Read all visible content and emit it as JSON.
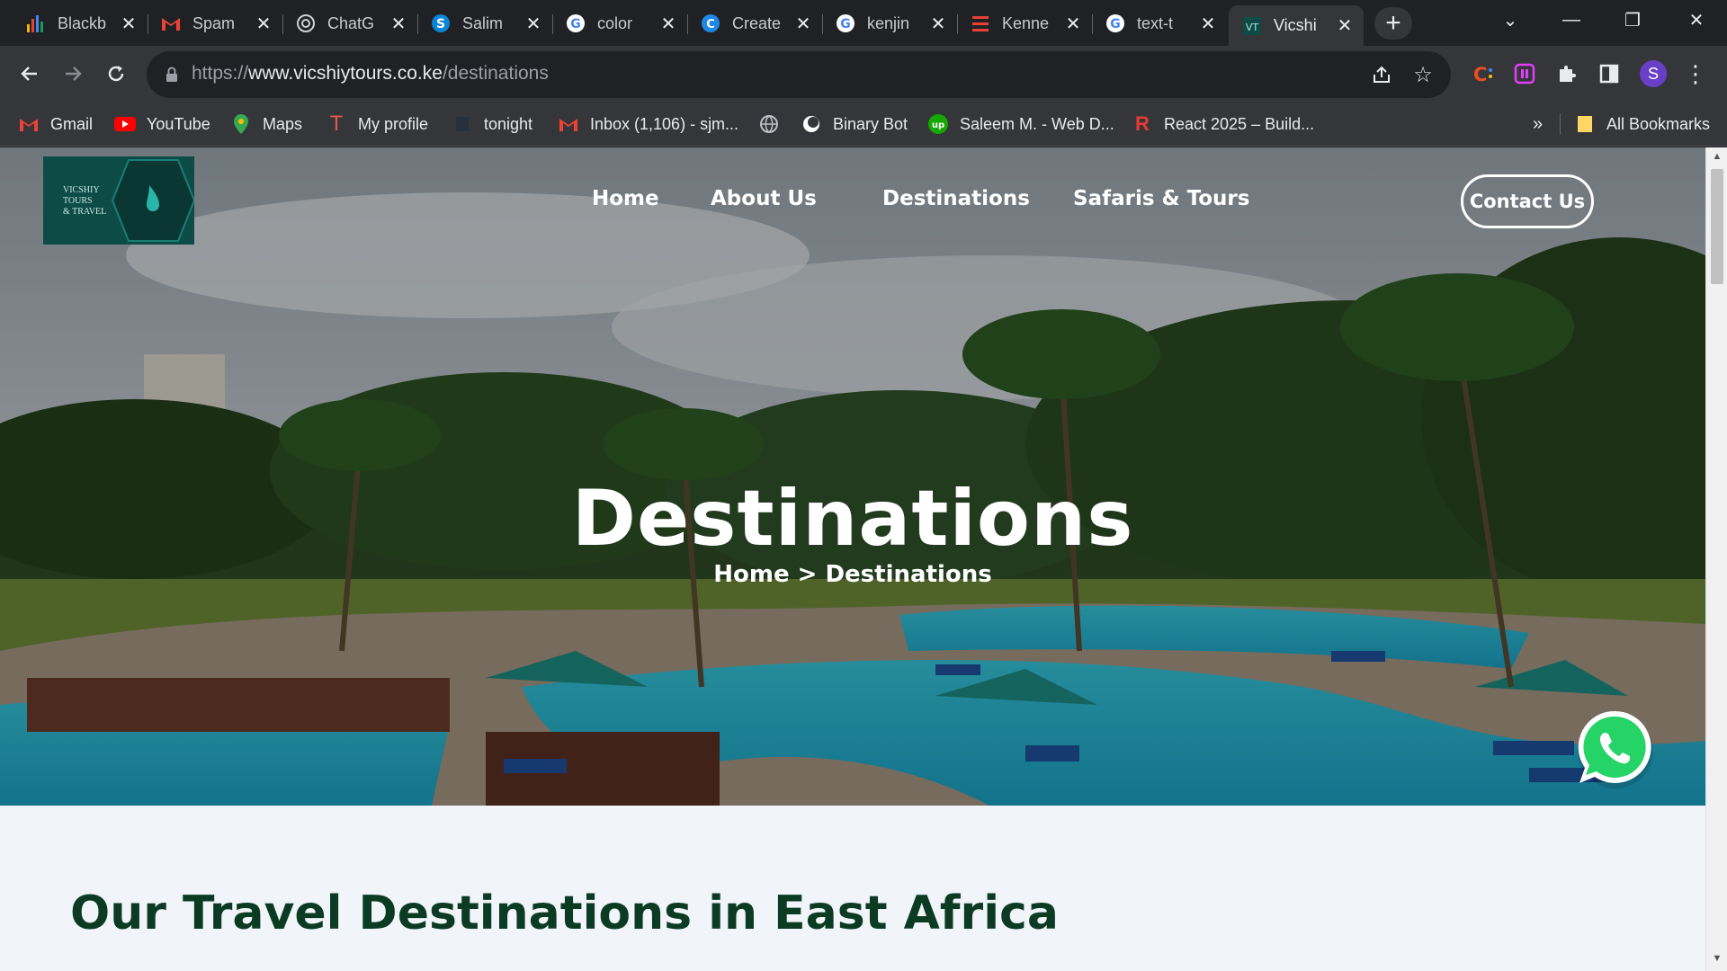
{
  "browser": {
    "tabs": [
      {
        "label": "Blackb",
        "icon": "bar-chart-icon"
      },
      {
        "label": "Spam",
        "icon": "gmail-icon"
      },
      {
        "label": "ChatG",
        "icon": "chatgpt-icon"
      },
      {
        "label": "Salim",
        "icon": "skype-icon"
      },
      {
        "label": "color",
        "icon": "google-icon"
      },
      {
        "label": "Create",
        "icon": "canva-icon"
      },
      {
        "label": "kenjin",
        "icon": "google-icon"
      },
      {
        "label": "Kenne",
        "icon": "stack-icon"
      },
      {
        "label": "text-t",
        "icon": "google-icon"
      },
      {
        "label": "Vicshi",
        "icon": "site-favicon",
        "active": true
      }
    ],
    "address": {
      "scheme": "https://",
      "host": "www.vicshiytours.co.ke",
      "path": "/destinations"
    },
    "bookmarks": [
      {
        "label": "Gmail",
        "icon": "gmail-icon"
      },
      {
        "label": "YouTube",
        "icon": "youtube-icon"
      },
      {
        "label": "Maps",
        "icon": "maps-icon"
      },
      {
        "label": "My profile",
        "icon": "profile-t-icon"
      },
      {
        "label": "tonight",
        "icon": "bookmark-icon"
      },
      {
        "label": "Inbox (1,106) - sjm...",
        "icon": "gmail-icon"
      },
      {
        "label": "",
        "icon": "globe-icon"
      },
      {
        "label": "Binary Bot",
        "icon": "binary-bot-icon"
      },
      {
        "label": "Saleem M. - Web D...",
        "icon": "upwork-icon"
      },
      {
        "label": "React 2025 – Build...",
        "icon": "react-course-icon"
      }
    ],
    "bookmarks_overflow": "»",
    "all_bookmarks": "All Bookmarks",
    "profile_initial": "S"
  },
  "site": {
    "logo_text": [
      "VICSHIY",
      "TOURS",
      "& TRAVEL"
    ],
    "nav": [
      "Home",
      "About Us",
      "Destinations",
      "Safaris & Tours"
    ],
    "contact_label": "Contact Us",
    "hero_title": "Destinations",
    "breadcrumb": "Home > Destinations",
    "section_title": "Our Travel Destinations in East Africa"
  },
  "colors": {
    "chrome_dark": "#202124",
    "chrome_toolbar": "#35363a",
    "brand_teal": "#0d4b47",
    "heading_green": "#0c3b24",
    "page_bg": "#f1f4f8",
    "whatsapp_green": "#25d366"
  }
}
